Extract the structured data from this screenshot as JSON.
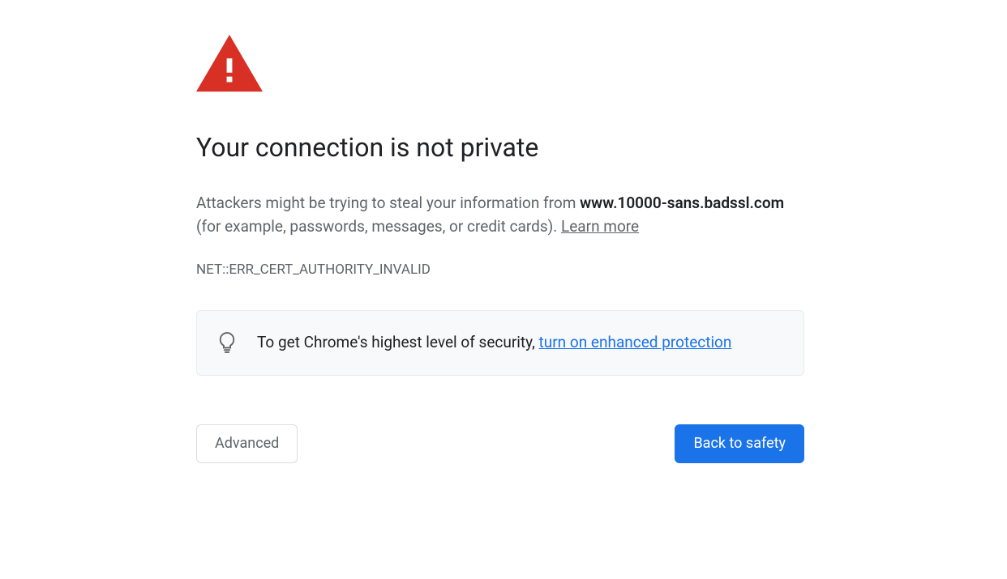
{
  "title": "Your connection is not private",
  "body": {
    "prefix": "Attackers might be trying to steal your information from ",
    "hostname": "www.10000-sans.badssl.com",
    "suffix": " (for example, passwords, messages, or credit cards). ",
    "learn_more": "Learn more"
  },
  "error_code": "NET::ERR_CERT_AUTHORITY_INVALID",
  "promo": {
    "prefix": "To get Chrome's highest level of security, ",
    "link_text": "turn on enhanced protection"
  },
  "buttons": {
    "advanced": "Advanced",
    "back_to_safety": "Back to safety"
  },
  "colors": {
    "danger": "#d93025",
    "primary": "#1a73e8",
    "text_secondary": "#5f6368"
  }
}
